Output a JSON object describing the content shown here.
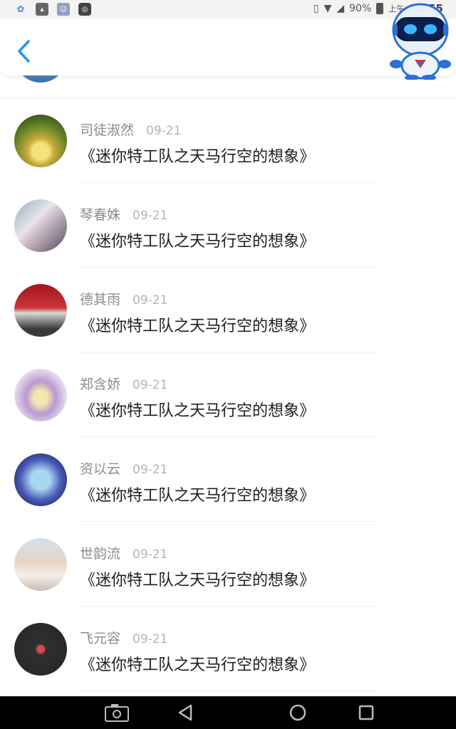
{
  "status_bar": {
    "battery": "90%",
    "ampm": "上午",
    "time": "11:55",
    "notification_icons": [
      "app-icon",
      "image-icon",
      "robot-app-icon",
      "sync-icon"
    ]
  },
  "header": {
    "back_icon": "chevron-left-icon",
    "accent_color": "#2196f3"
  },
  "list": {
    "items": [
      {
        "author": "司徒淑然",
        "date": "09-21",
        "title": "《迷你特工队之天马行空的想象》"
      },
      {
        "author": "琴春姝",
        "date": "09-21",
        "title": "《迷你特工队之天马行空的想象》"
      },
      {
        "author": "德其雨",
        "date": "09-21",
        "title": "《迷你特工队之天马行空的想象》"
      },
      {
        "author": "郑含娇",
        "date": "09-21",
        "title": "《迷你特工队之天马行空的想象》"
      },
      {
        "author": "资以云",
        "date": "09-21",
        "title": "《迷你特工队之天马行空的想象》"
      },
      {
        "author": "世韵流",
        "date": "09-21",
        "title": "《迷你特工队之天马行空的想象》"
      },
      {
        "author": "飞元容",
        "date": "09-21",
        "title": "《迷你特工队之天马行空的想象》"
      }
    ]
  },
  "nav_bar": {
    "icons": [
      "screenshot-icon",
      "back-triangle-icon",
      "home-circle-icon",
      "recents-square-icon"
    ]
  }
}
